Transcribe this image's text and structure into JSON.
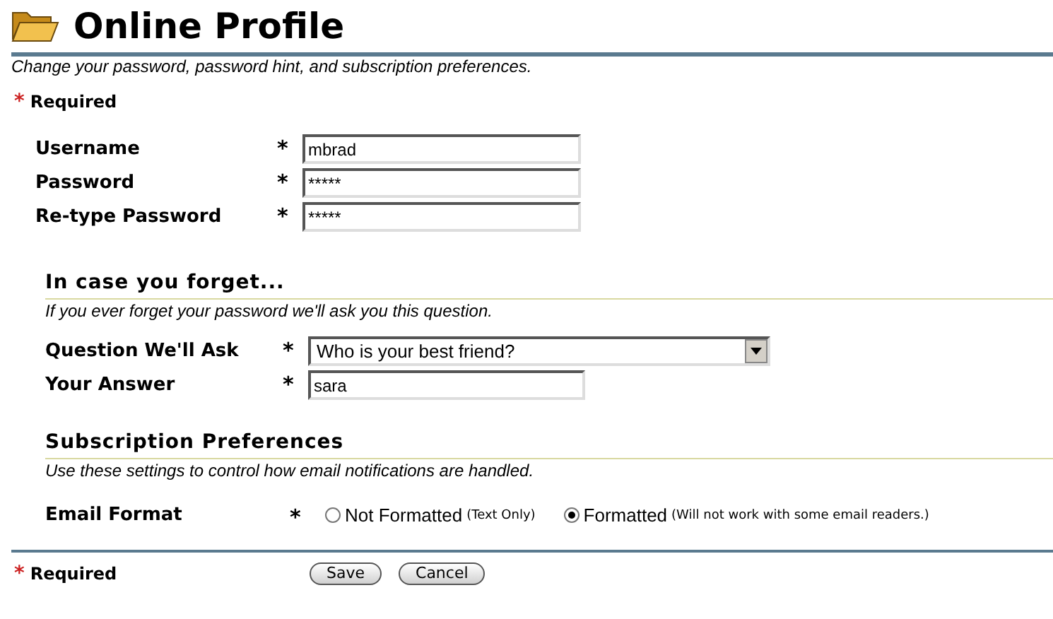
{
  "title": "Online Profile",
  "subtitle": "Change your password, password hint, and subscription preferences.",
  "required_top": {
    "mark": "*",
    "label": "Required"
  },
  "account_fields": [
    {
      "label": "Username",
      "mark": "*",
      "value": "mbrad"
    },
    {
      "label": "Password",
      "mark": "*",
      "value": "*****"
    },
    {
      "label": "Re-type Password",
      "mark": "*",
      "value": "*****"
    }
  ],
  "hint_section": {
    "heading": "In case you forget...",
    "description": "If you ever forget your password we'll ask you this question.",
    "fields": [
      {
        "kind": "select",
        "label": "Question We'll Ask",
        "mark": "*",
        "value": "Who is your best friend?"
      },
      {
        "kind": "text",
        "label": "Your Answer",
        "mark": "*",
        "value": "sara"
      }
    ]
  },
  "subscription_section": {
    "heading": "Subscription Preferences",
    "description": "Use these settings to control how email notifications are handled.",
    "email_format": {
      "label": "Email Format",
      "mark": "*",
      "options": [
        {
          "label": "Not Formatted",
          "note": "(Text Only)",
          "selected": false
        },
        {
          "label": "Formatted",
          "note": "(Will not work with some email readers.)",
          "selected": true
        }
      ]
    }
  },
  "required_bottom": {
    "mark": "*",
    "label": "Required"
  },
  "buttons": [
    "Save",
    "Cancel"
  ]
}
